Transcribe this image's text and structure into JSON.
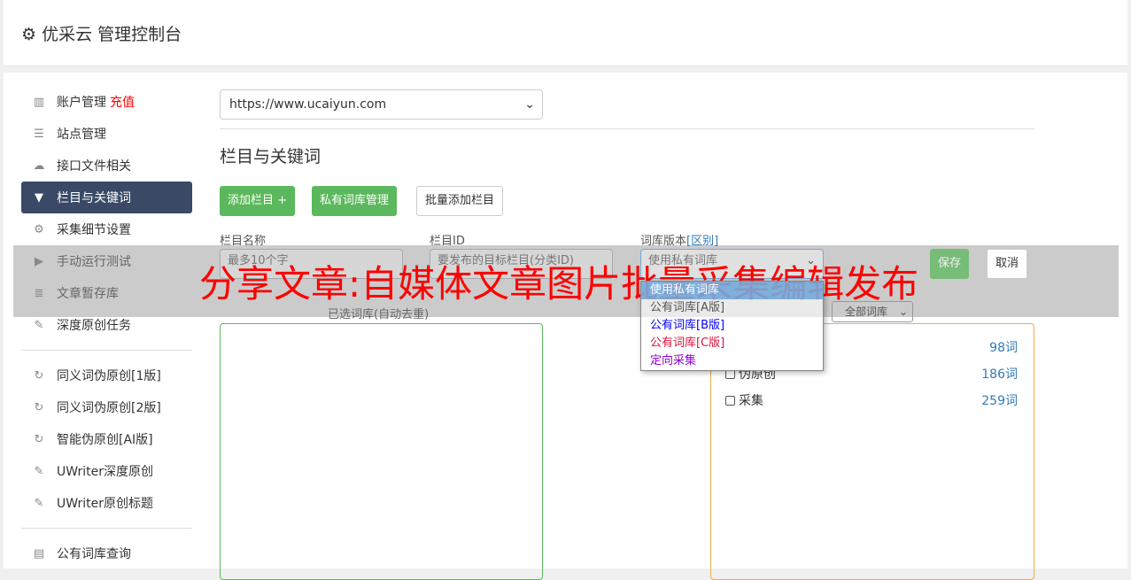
{
  "header": {
    "title": "优采云 管理控制台",
    "icon": "gear-icon"
  },
  "sidebar": {
    "items": [
      {
        "label": "账户管理",
        "badge": "充值",
        "icon": "bar-chart-icon"
      },
      {
        "label": "站点管理",
        "icon": "server-icon"
      },
      {
        "label": "接口文件相关",
        "icon": "cloud-upload-icon"
      },
      {
        "label": "栏目与关键词",
        "icon": "filter-icon",
        "active": true
      },
      {
        "label": "采集细节设置",
        "icon": "gears-icon"
      },
      {
        "label": "手动运行测试",
        "icon": "play-circle-icon"
      },
      {
        "label": "文章暂存库",
        "icon": "database-icon"
      },
      {
        "label": "深度原创任务",
        "icon": "edit-icon"
      },
      {
        "label": "同义词伪原创[1版]",
        "icon": "refresh-icon"
      },
      {
        "label": "同义词伪原创[2版]",
        "icon": "refresh-icon"
      },
      {
        "label": "智能伪原创[AI版]",
        "icon": "refresh-icon"
      },
      {
        "label": "UWriter深度原创",
        "icon": "edit-icon"
      },
      {
        "label": "UWriter原创标题",
        "icon": "edit-icon"
      },
      {
        "label": "公有词库查询",
        "icon": "book-icon"
      }
    ]
  },
  "main": {
    "site_select": "https://www.ucaiyun.com",
    "title": "栏目与关键词",
    "buttons": {
      "add": "添加栏目 +",
      "private": "私有词库管理",
      "batch": "批量添加栏目",
      "save": "保存",
      "cancel": "取消"
    },
    "form": {
      "name_label": "栏目名称",
      "name_placeholder": "最多10个字",
      "id_label": "栏目ID",
      "id_placeholder": "要发布的目标栏目(分类ID)",
      "version_label": "词库版本",
      "version_link": "[区别]",
      "version_value": "使用私有词库"
    },
    "dropdown": [
      {
        "label": "使用私有词库",
        "color": "#ffffff"
      },
      {
        "label": "公有词库[A版]",
        "color": "#555555"
      },
      {
        "label": "公有词库[B版]",
        "color": "#0000ff"
      },
      {
        "label": "公有词库[C版]",
        "color": "#dc143c"
      },
      {
        "label": "定向采集",
        "color": "#9400d3"
      }
    ],
    "selected_label": "已选词库(自动去重)",
    "filter_select": "全部词库",
    "libraries": [
      {
        "name": "",
        "count": "98词"
      },
      {
        "name": "伪原创",
        "count": "186词"
      },
      {
        "name": "采集",
        "count": "259词"
      }
    ]
  },
  "banner": "分享文章:自媒体文章图片批量采集编辑发布"
}
